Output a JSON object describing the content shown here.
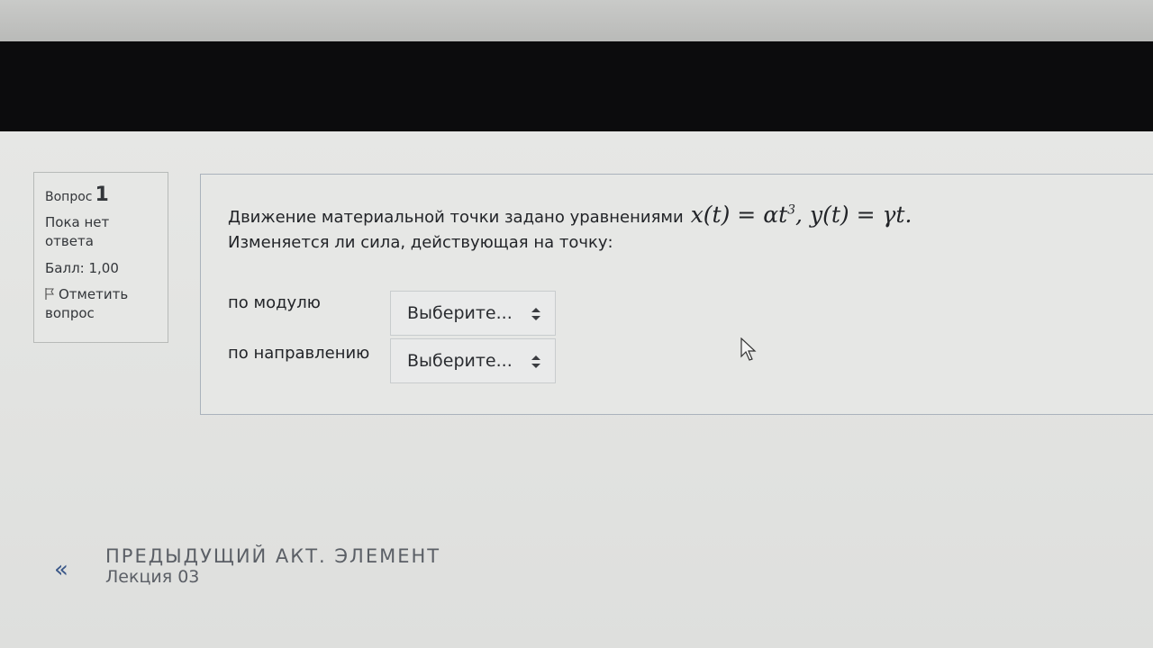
{
  "question_info": {
    "label": "Вопрос",
    "number": "1",
    "state_line1": "Пока нет",
    "state_line2": "ответа",
    "grade": "Балл: 1,00",
    "flag_line1": "Отметить",
    "flag_line2": "вопрос"
  },
  "question": {
    "text_line1": "Движение материальной точки задано уравнениями",
    "formula_x": "x(t) = αt",
    "formula_exp": "3",
    "formula_y": ", y(t) = γt.",
    "text_line2": "Изменяется ли сила, действующая на точку:"
  },
  "rows": [
    {
      "label": "по модулю",
      "select_value": "Выберите..."
    },
    {
      "label": "по направлению",
      "select_value": "Выберите..."
    }
  ],
  "navigation": {
    "arrow": "«",
    "title": "ПРЕДЫДУЩИЙ АКТ. ЭЛЕМЕНТ",
    "subtitle": "Лекция 03"
  },
  "icons": {
    "flag": "flag-icon",
    "select": "updown-arrows-icon",
    "cursor": "mouse-cursor-icon"
  },
  "colors": {
    "nav_arrow": "#3a5788",
    "content_border": "#aab2bc"
  }
}
